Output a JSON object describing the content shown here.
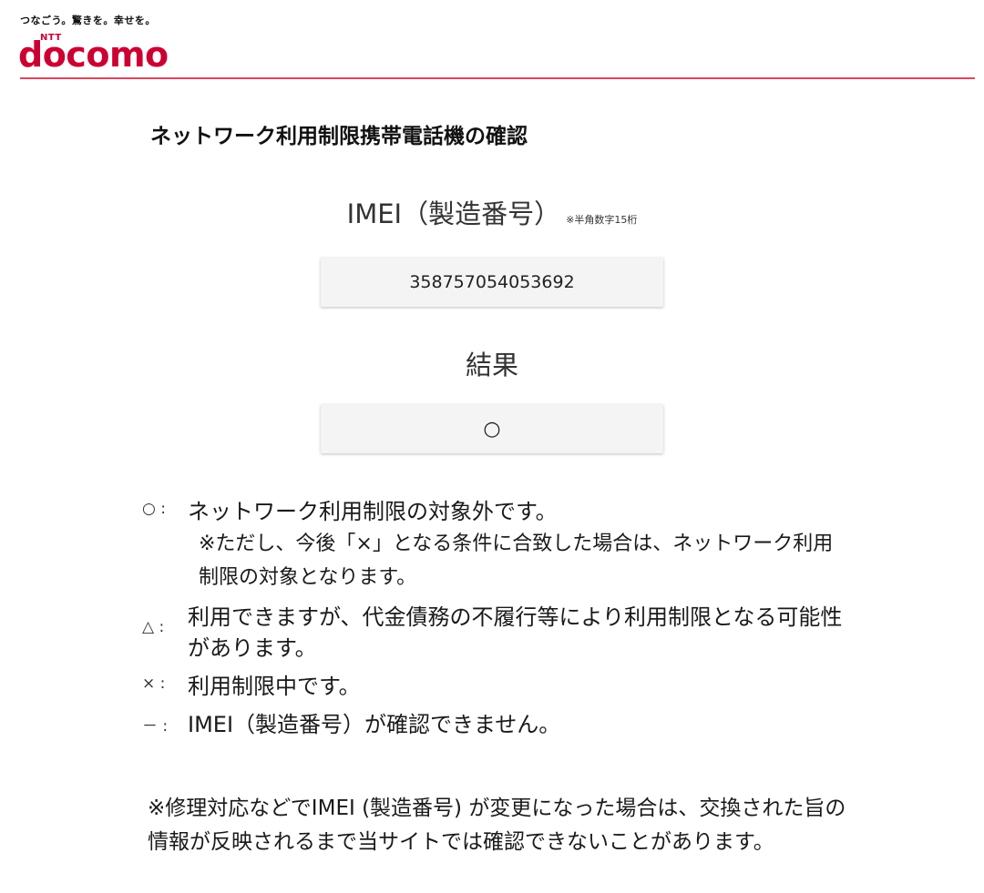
{
  "header": {
    "tagline": "つなごう。驚きを。幸せを。",
    "logo_small": "NTT",
    "logo_word": "docomo"
  },
  "page_title": "ネットワーク利用制限携帯電話機の確認",
  "imei": {
    "label": "IMEI（製造番号）",
    "note": "※半角数字15桁",
    "value": "358757054053692"
  },
  "result": {
    "label": "結果",
    "value": "○"
  },
  "legend": [
    {
      "symbol": "○ :",
      "text": "ネットワーク利用制限の対象外です。",
      "sub": "※ただし、今後「×」となる条件に合致した場合は、ネットワーク利用制限の対象となります。"
    },
    {
      "symbol": "△ :",
      "text": "利用できますが、代金債務の不履行等により利用制限となる可能性があります。",
      "sub": ""
    },
    {
      "symbol": "× :",
      "text": "利用制限中です。",
      "sub": ""
    },
    {
      "symbol": "－ :",
      "text": "IMEI（製造番号）が確認できません。",
      "sub": ""
    }
  ],
  "footnote": "※修理対応などでIMEI (製造番号) が変更になった場合は、交換された旨の情報が反映されるまで当サイトでは確認できないことがあります。",
  "colors": {
    "brand": "#cc0033",
    "rule": "#d8475f",
    "box_bg": "#f4f4f4"
  }
}
